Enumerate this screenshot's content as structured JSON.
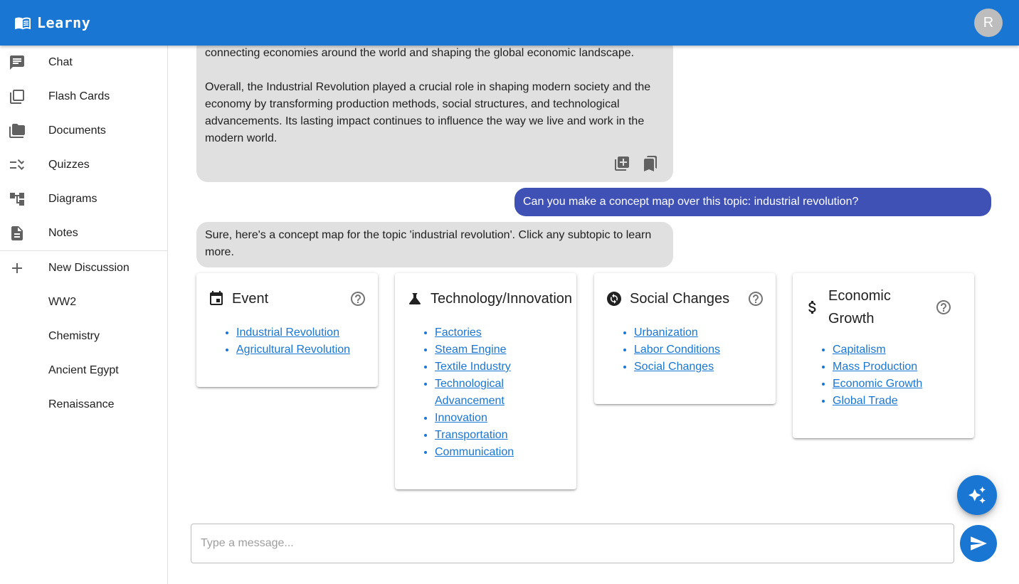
{
  "app": {
    "title": "Learny",
    "avatar_initial": "R"
  },
  "sidebar": {
    "nav": [
      {
        "label": "Chat",
        "icon": "chat-icon"
      },
      {
        "label": "Flash Cards",
        "icon": "flash-cards-icon"
      },
      {
        "label": "Documents",
        "icon": "folder-icon"
      },
      {
        "label": "Quizzes",
        "icon": "quiz-icon"
      },
      {
        "label": "Diagrams",
        "icon": "diagram-icon"
      },
      {
        "label": "Notes",
        "icon": "notes-icon"
      }
    ],
    "new_discussion": "New Discussion",
    "discussions": [
      "WW2",
      "Chemistry",
      "Ancient Egypt",
      "Renaissance"
    ]
  },
  "chat": {
    "ai_message_1": {
      "p1": "connecting economies around the world and shaping the global economic landscape.",
      "p2": "Overall, the Industrial Revolution played a crucial role in shaping modern society and the economy by transforming production methods, social structures, and technological advancements. Its lasting impact continues to influence the way we live and work in the modern world."
    },
    "user_message": "Can you make a concept map over this topic: industrial revolution?",
    "ai_message_2": "Sure, here's a concept map for the topic 'industrial revolution'. Click any subtopic to learn more."
  },
  "concept_map": [
    {
      "title": "Event",
      "icon": "calendar-icon",
      "items": [
        "Industrial Revolution",
        "Agricultural Revolution"
      ]
    },
    {
      "title": "Technology/Innovation",
      "icon": "flask-icon",
      "items": [
        "Factories",
        "Steam Engine",
        "Textile Industry",
        "Technological Advancement",
        "Innovation",
        "Transportation",
        "Communication"
      ]
    },
    {
      "title": "Social Changes",
      "icon": "sync-icon",
      "items": [
        "Urbanization",
        "Labor Conditions",
        "Social Changes"
      ]
    },
    {
      "title": "Economic Growth",
      "icon": "dollar-icon",
      "items": [
        "Capitalism",
        "Mass Production",
        "Economic Growth",
        "Global Trade"
      ]
    }
  ],
  "composer": {
    "placeholder": "Type a message..."
  },
  "colors": {
    "appbar": "#1976d2",
    "user_bubble": "#3f51b5",
    "ai_bubble": "#e0e0e0",
    "link": "#1976d2"
  }
}
